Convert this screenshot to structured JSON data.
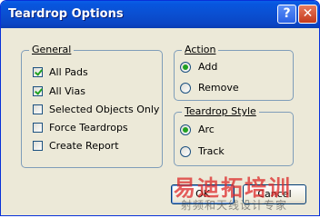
{
  "window": {
    "title": "Teardrop Options",
    "help_glyph": "?",
    "close_glyph": "✕"
  },
  "general": {
    "legend": "General",
    "items": [
      {
        "label": "All Pads",
        "checked": true
      },
      {
        "label": "All Vias",
        "checked": true
      },
      {
        "label": "Selected Objects Only",
        "checked": false
      },
      {
        "label": "Force Teardrops",
        "checked": false
      },
      {
        "label": "Create Report",
        "checked": false
      }
    ]
  },
  "action": {
    "legend": "Action",
    "options": [
      {
        "label": "Add",
        "selected": true
      },
      {
        "label": "Remove",
        "selected": false
      }
    ]
  },
  "teardrop_style": {
    "legend": "Teardrop Style",
    "options": [
      {
        "label": "Arc",
        "selected": true
      },
      {
        "label": "Track",
        "selected": false
      }
    ]
  },
  "buttons": {
    "ok": "OK",
    "cancel": "Cancel"
  },
  "watermark": {
    "line1": "易迪拓培训",
    "line2": "射频和天线设计专家"
  },
  "colors": {
    "titlebar": "#0a4fd1",
    "dialog_bg": "#ece9d8",
    "group_border": "#7f9db9",
    "check_green": "#21a121"
  }
}
